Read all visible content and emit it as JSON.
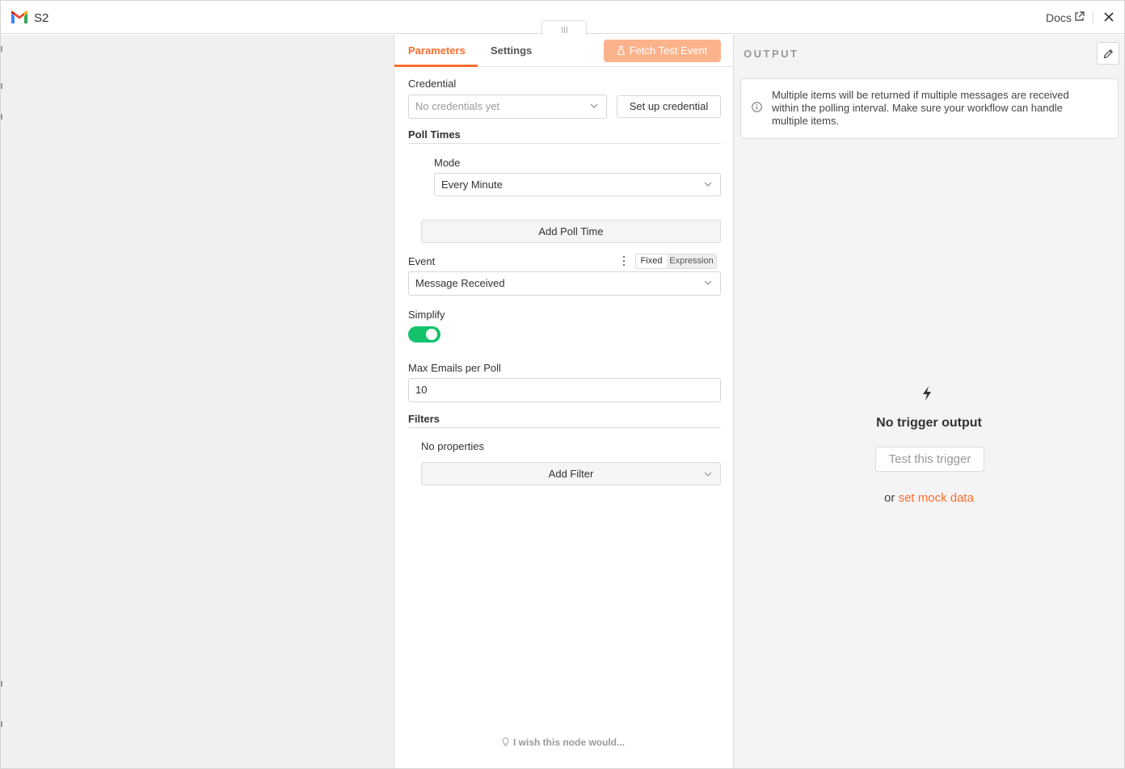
{
  "header": {
    "node_name": "S2",
    "docs_label": "Docs"
  },
  "tabs": {
    "parameters": "Parameters",
    "settings": "Settings"
  },
  "fetch_button": "Fetch Test Event",
  "credential": {
    "label": "Credential",
    "placeholder": "No credentials yet",
    "setup_button": "Set up credential"
  },
  "poll_times": {
    "label": "Poll Times",
    "mode_label": "Mode",
    "mode_value": "Every Minute",
    "add_button": "Add Poll Time"
  },
  "event": {
    "label": "Event",
    "fixed_label": "Fixed",
    "expression_label": "Expression",
    "value": "Message Received"
  },
  "simplify": {
    "label": "Simplify",
    "enabled": true
  },
  "max_emails": {
    "label": "Max Emails per Poll",
    "value": "10"
  },
  "filters": {
    "label": "Filters",
    "empty_text": "No properties",
    "add_button": "Add Filter"
  },
  "feedback": "I wish this node would...",
  "output": {
    "title": "OUTPUT",
    "callout": "Multiple items will be returned if multiple messages are received within the polling interval. Make sure your workflow can handle multiple items.",
    "empty_title": "No trigger output",
    "test_button": "Test this trigger",
    "or_text": "or",
    "mock_link": "set mock data"
  },
  "colors": {
    "accent": "#ff6d2d",
    "toggle_on": "#13c26b",
    "fetch_button_bg": "#fcb38c"
  }
}
